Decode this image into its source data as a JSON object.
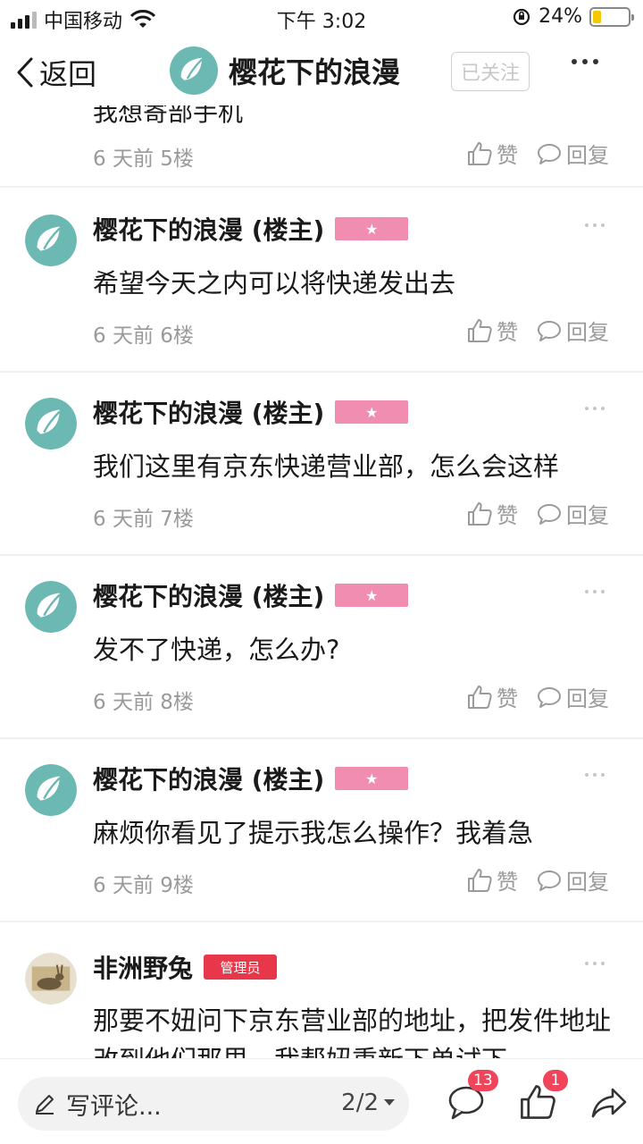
{
  "status_bar": {
    "carrier": "中国移动",
    "time": "下午 3:02",
    "battery_percent": "24%",
    "battery_level": 0.24
  },
  "nav": {
    "back_label": "返回",
    "title": "樱花下的浪漫",
    "follow_label": "已关注"
  },
  "partial_comment": {
    "text": "我想寄部手机",
    "meta": "6 天前  5楼",
    "like_label": "赞",
    "reply_label": "回复"
  },
  "comments": [
    {
      "author": "樱花下的浪漫 (楼主)",
      "badge": "★",
      "text": "希望今天之内可以将快递发出去",
      "meta": "6 天前  6楼",
      "like_label": "赞",
      "reply_label": "回复"
    },
    {
      "author": "樱花下的浪漫 (楼主)",
      "badge": "★",
      "text": "我们这里有京东快递营业部，怎么会这样",
      "meta": "6 天前  7楼",
      "like_label": "赞",
      "reply_label": "回复"
    },
    {
      "author": "樱花下的浪漫 (楼主)",
      "badge": "★",
      "text": "发不了快递，怎么办?",
      "meta": "6 天前  8楼",
      "like_label": "赞",
      "reply_label": "回复"
    },
    {
      "author": "樱花下的浪漫 (楼主)",
      "badge": "★",
      "text": "麻烦你看见了提示我怎么操作？我着急",
      "meta": "6 天前  9楼",
      "like_label": "赞",
      "reply_label": "回复"
    }
  ],
  "admin_comment": {
    "author": "非洲野兔",
    "badge": "管理员",
    "text": "那要不妞问下京东营业部的地址，把发件地址改到他们那里，我帮妞重新下单试下"
  },
  "bottom_bar": {
    "input_placeholder": "写评论...",
    "page_indicator": "2/2",
    "comments_count": "13",
    "likes_count": "1"
  },
  "colors": {
    "brand_teal": "#6cb8b3",
    "badge_pink": "#f08db0",
    "admin_red": "#e8374a",
    "count_badge": "#f0445a"
  }
}
